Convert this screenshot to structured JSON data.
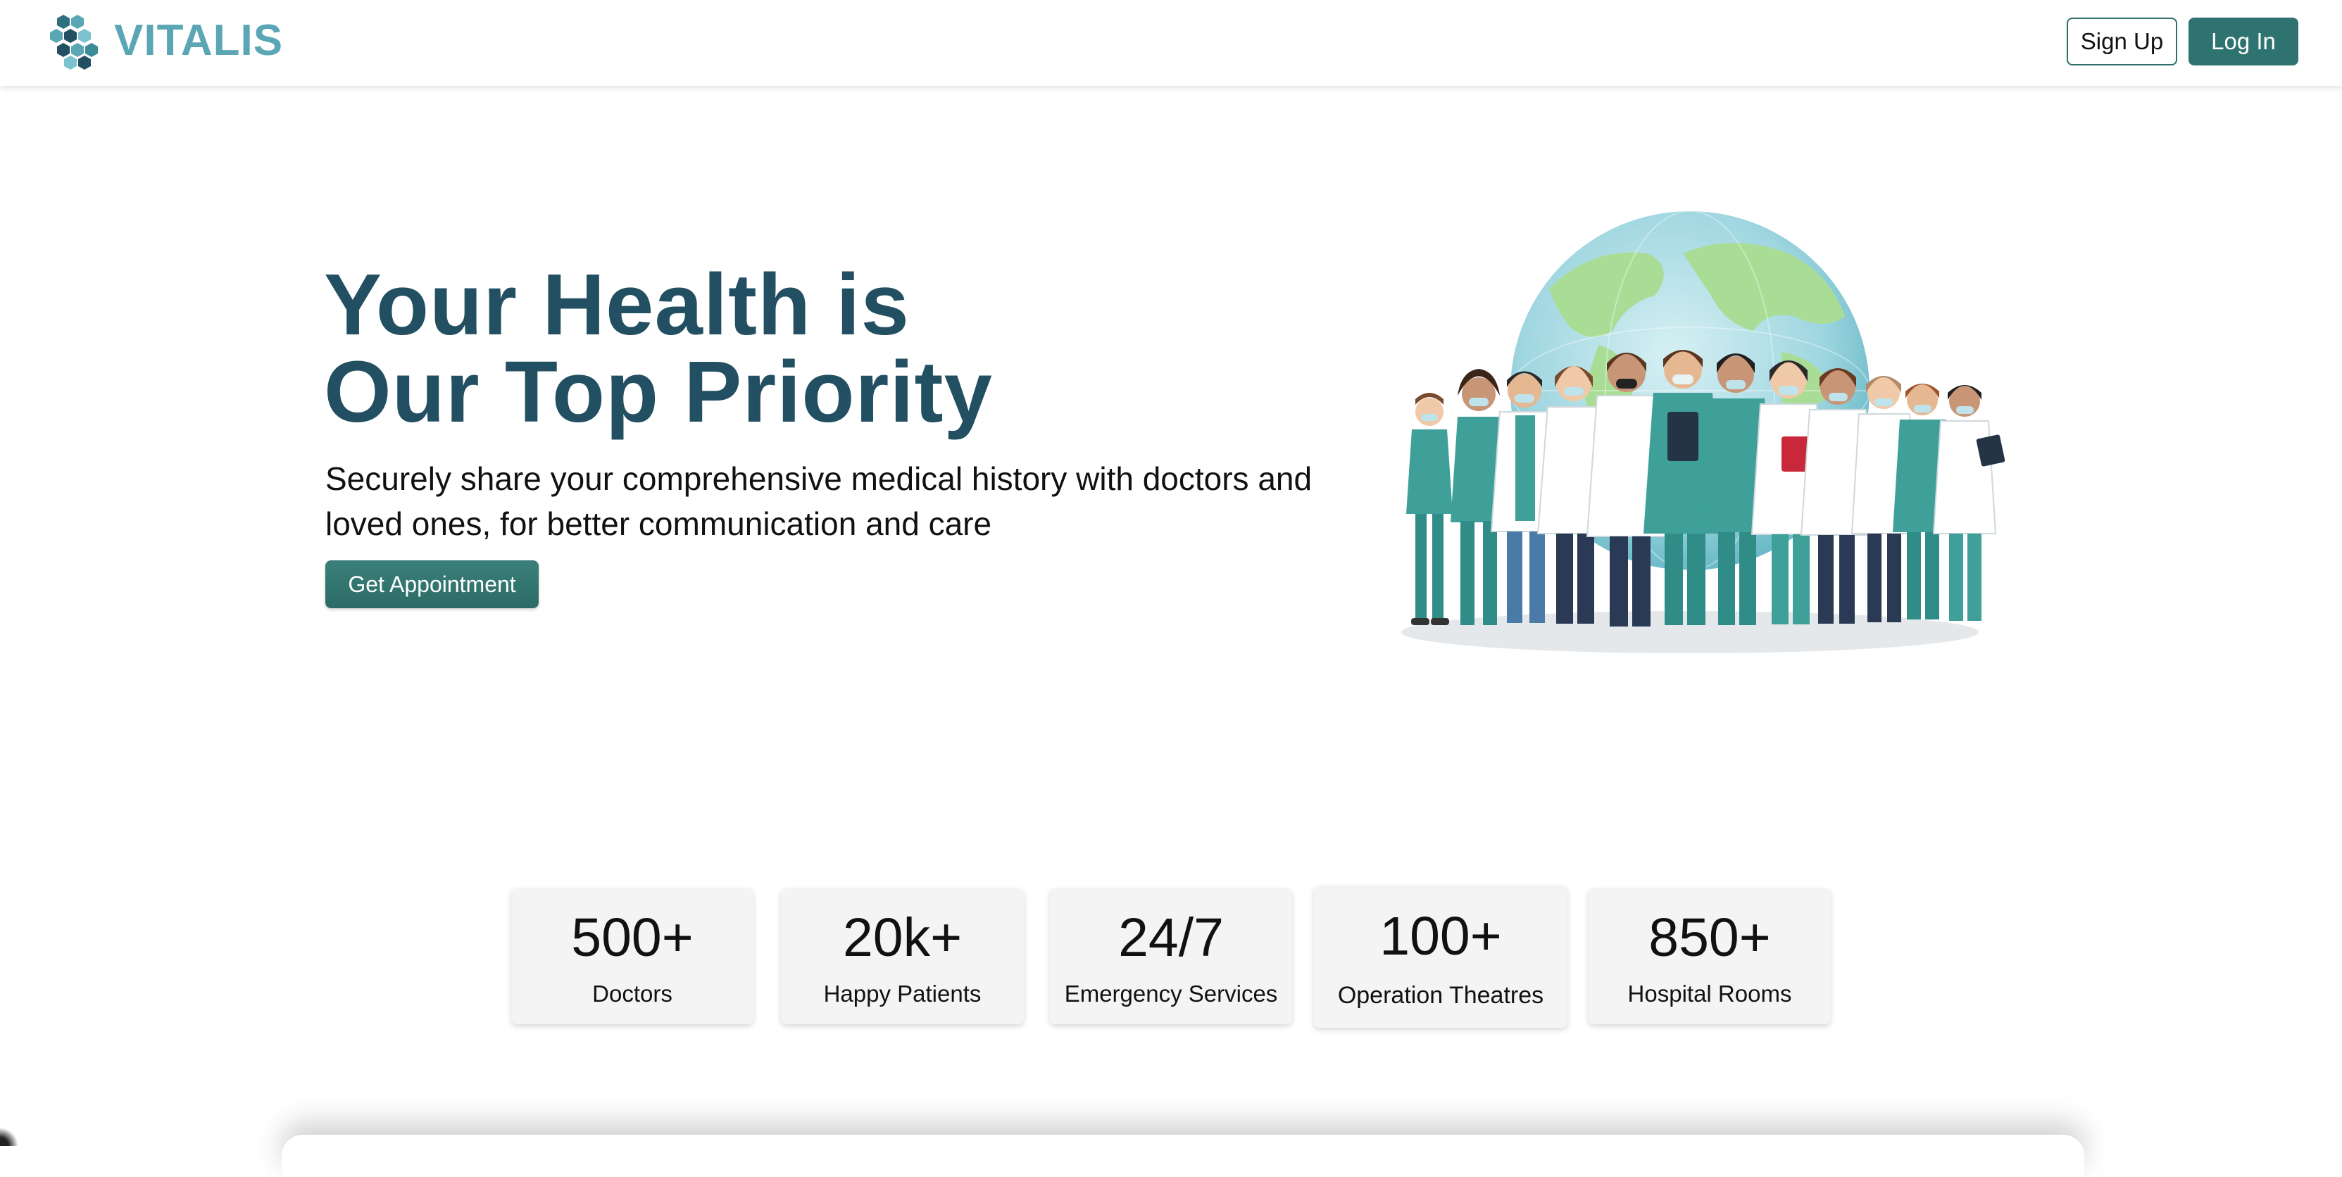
{
  "header": {
    "brand": "VITALIS",
    "signup_label": "Sign Up",
    "login_label": "Log In"
  },
  "hero": {
    "title_line1": "Your Health is",
    "title_line2": "Our Top Priority",
    "subtitle": "Securely share your comprehensive medical history with doctors and loved ones, for better communication and care",
    "cta_label": "Get Appointment"
  },
  "stats": [
    {
      "value": "500+",
      "label": "Doctors"
    },
    {
      "value": "20k+",
      "label": "Happy Patients"
    },
    {
      "value": "24/7",
      "label": "Emergency Services"
    },
    {
      "value": "100+",
      "label": "Operation Theatres"
    },
    {
      "value": "850+",
      "label": "Hospital Rooms"
    }
  ],
  "colors": {
    "brand": "#5aa6b5",
    "primary_button": "#2f7370",
    "heading": "#234f62"
  },
  "icons": {
    "logo": "hexagon-cluster-logo",
    "illustration": "medical-team-with-globe"
  }
}
